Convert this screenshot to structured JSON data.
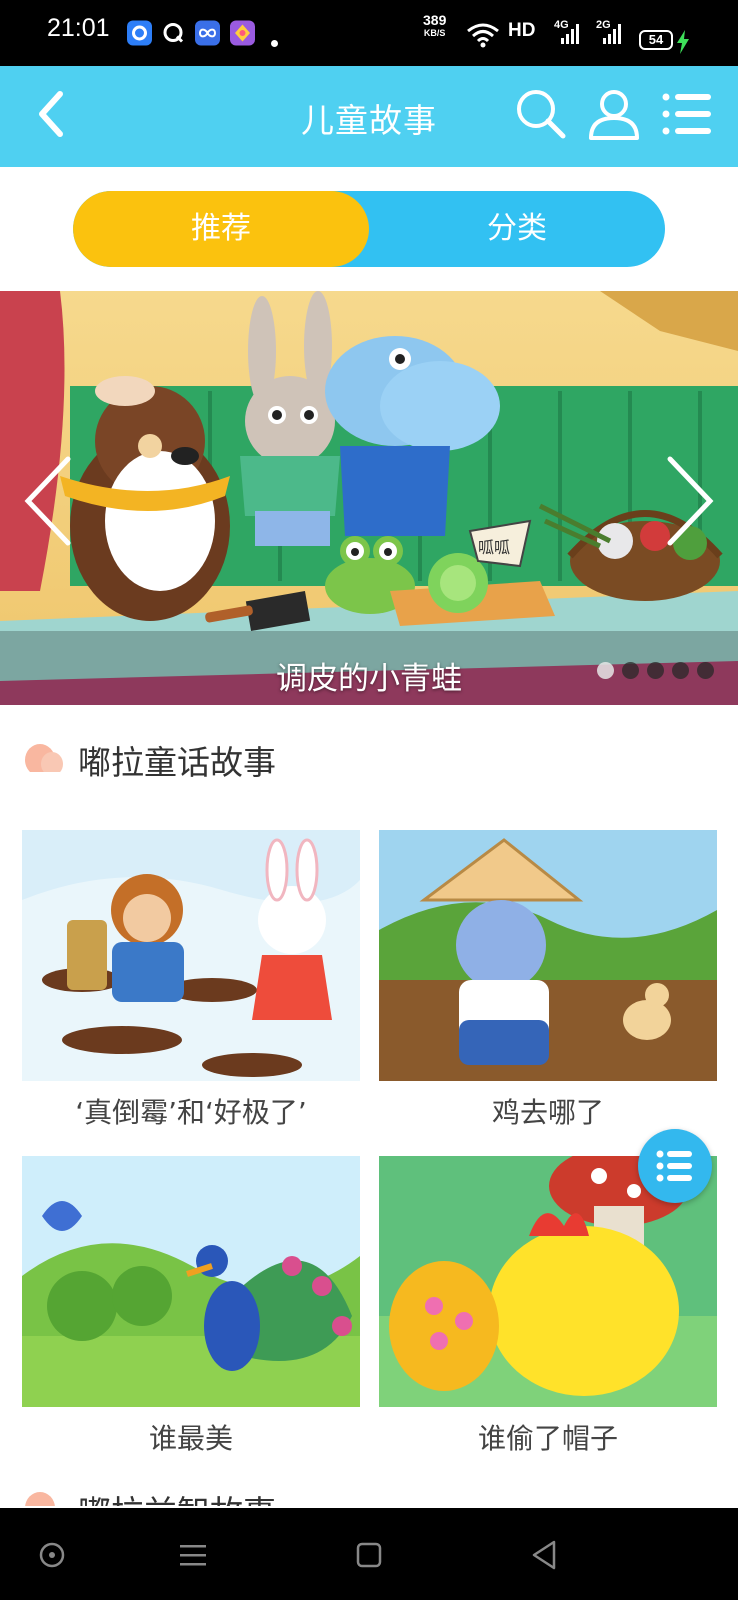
{
  "status_bar": {
    "time": "21:01",
    "net_speed_value": "389",
    "net_speed_unit": "KB/S",
    "hd_label": "HD",
    "signal1_label": "4G",
    "signal2_label": "2G",
    "battery": "54"
  },
  "header": {
    "title": "儿童故事",
    "back_icon": "chevron-left-icon",
    "search_icon": "search-icon",
    "user_icon": "user-icon",
    "menu_icon": "list-menu-icon"
  },
  "tabs": [
    {
      "label": "推荐",
      "active": true
    },
    {
      "label": "分类",
      "active": false
    }
  ],
  "banner": {
    "caption": "调皮的小青蛙",
    "sign_text": "呱呱",
    "slide_count": 5,
    "active_slide": 1
  },
  "section": {
    "title": "嘟拉童话故事",
    "items": [
      {
        "title": "‘真倒霉’和‘好极了’"
      },
      {
        "title": "鸡去哪了"
      },
      {
        "title": "谁最美"
      },
      {
        "title": "谁偷了帽子"
      }
    ]
  },
  "next_section": {
    "title": "嘟拉益智故事"
  },
  "colors": {
    "header_bg": "#4fd0f1",
    "tab_active": "#fbc20e",
    "tab_inactive": "#32c1f2",
    "float_button": "#33b8ee"
  }
}
